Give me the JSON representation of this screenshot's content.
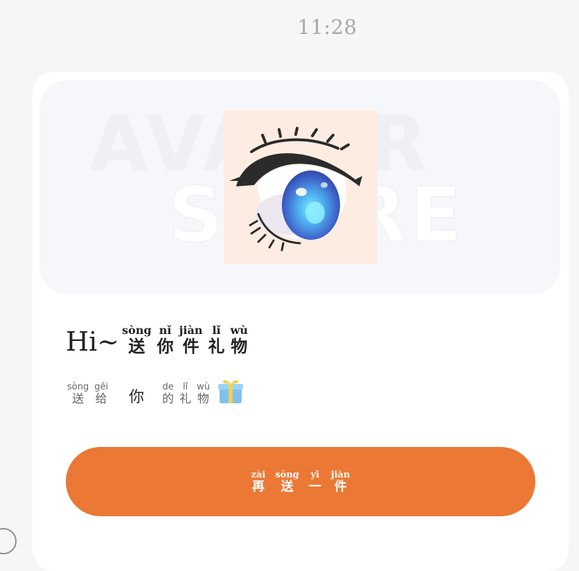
{
  "status": {
    "time": "11:28"
  },
  "banner": {
    "watermark_line1": "AVATAR",
    "watermark_line2": "STORE",
    "item_image": "anime-eye-avatar-part"
  },
  "gift_title": {
    "greeting": "Hi~",
    "chars": [
      {
        "pinyin": "sòng",
        "hanzi": "送"
      },
      {
        "pinyin": "nǐ",
        "hanzi": "你"
      },
      {
        "pinyin": "jiàn",
        "hanzi": "件"
      },
      {
        "pinyin": "lǐ",
        "hanzi": "礼"
      },
      {
        "pinyin": "wù",
        "hanzi": "物"
      }
    ]
  },
  "gift_subtitle": {
    "before": [
      {
        "pinyin": "sòng",
        "hanzi": "送"
      },
      {
        "pinyin": "gěi",
        "hanzi": "给"
      }
    ],
    "recipient": "你",
    "after": [
      {
        "pinyin": "de",
        "hanzi": "的"
      },
      {
        "pinyin": "lǐ",
        "hanzi": "礼"
      },
      {
        "pinyin": "wù",
        "hanzi": "物"
      }
    ],
    "icon": "gift-box-icon"
  },
  "send_again_button": {
    "chars": [
      {
        "pinyin": "zài",
        "hanzi": "再"
      },
      {
        "pinyin": "sòng",
        "hanzi": "送"
      },
      {
        "pinyin": "yī",
        "hanzi": "一"
      },
      {
        "pinyin": "jiàn",
        "hanzi": "件"
      }
    ],
    "color": "#eb7834"
  },
  "colors": {
    "background": "#f6f6f7",
    "card": "#ffffff",
    "accent": "#eb7834"
  }
}
